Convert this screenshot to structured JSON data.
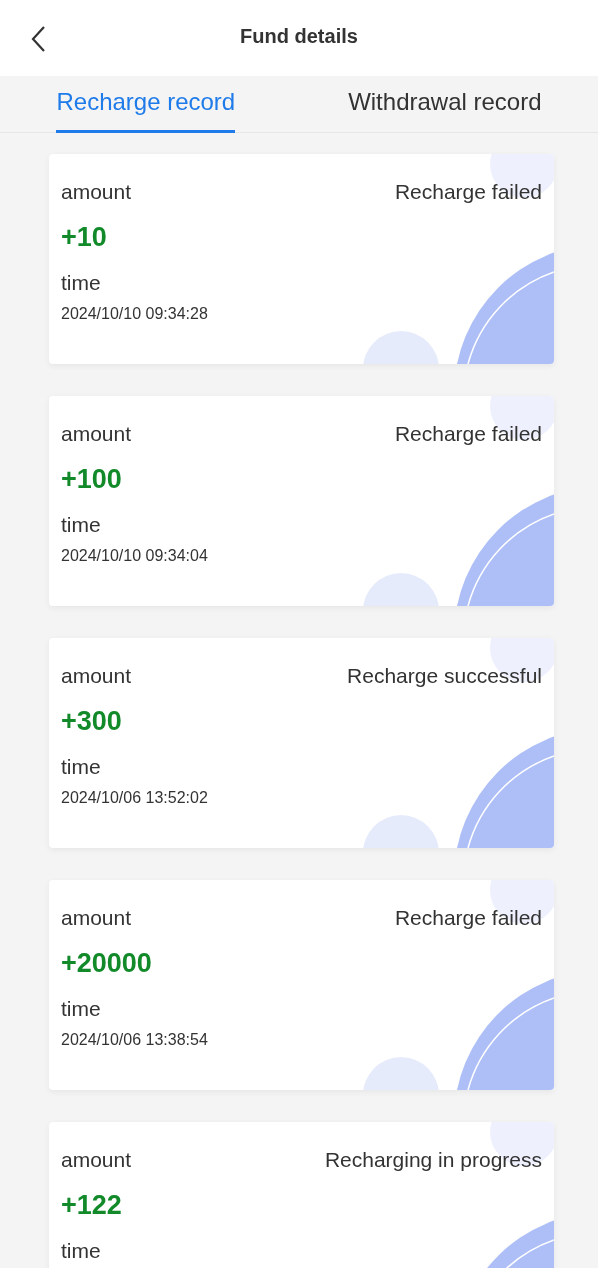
{
  "header": {
    "title": "Fund details"
  },
  "tabs": [
    {
      "label": "Recharge record",
      "selected": true
    },
    {
      "label": "Withdrawal record",
      "selected": false
    }
  ],
  "records": [
    {
      "amount_label": "amount",
      "status": "Recharge failed",
      "amount": "+10",
      "time_label": "time",
      "time": "2024/10/10 09:34:28"
    },
    {
      "amount_label": "amount",
      "status": "Recharge failed",
      "amount": "+100",
      "time_label": "time",
      "time": "2024/10/10 09:34:04"
    },
    {
      "amount_label": "amount",
      "status": "Recharge successful",
      "amount": "+300",
      "time_label": "time",
      "time": "2024/10/06 13:52:02"
    },
    {
      "amount_label": "amount",
      "status": "Recharge failed",
      "amount": "+20000",
      "time_label": "time",
      "time": "2024/10/06 13:38:54"
    },
    {
      "amount_label": "amount",
      "status": "Recharging in progress",
      "amount": "+122",
      "time_label": "time"
    }
  ]
}
